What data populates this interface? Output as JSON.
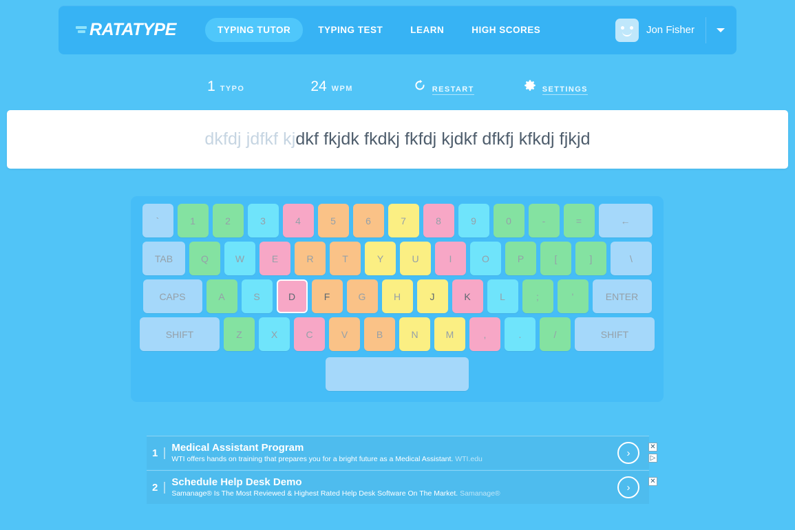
{
  "header": {
    "logo_text": "RATATYPE",
    "nav": [
      {
        "label": "TYPING TUTOR",
        "active": true
      },
      {
        "label": "TYPING TEST",
        "active": false
      },
      {
        "label": "LEARN",
        "active": false
      },
      {
        "label": "HIGH SCORES",
        "active": false
      }
    ],
    "username": "Jon Fisher"
  },
  "stats": {
    "typo_value": "1",
    "typo_label": "TYPO",
    "wpm_value": "24",
    "wpm_label": "WPM",
    "restart_label": "RESTART",
    "settings_label": "SETTINGS"
  },
  "typing": {
    "typed_text": "dkfdj jdfkf kj",
    "remaining_text": "dkf fkjdk fkdkj fkfdj kjdkf dfkfj kfkdj fjkjd"
  },
  "keyboard": {
    "active_key": "D",
    "rows": [
      [
        {
          "label": "`",
          "color": "blue",
          "width": "w-tick",
          "tone": "dim"
        },
        {
          "label": "1",
          "color": "green",
          "width": "",
          "tone": "dim"
        },
        {
          "label": "2",
          "color": "green",
          "width": "",
          "tone": "dim"
        },
        {
          "label": "3",
          "color": "cyan",
          "width": "",
          "tone": "dim"
        },
        {
          "label": "4",
          "color": "pink",
          "width": "",
          "tone": "dim"
        },
        {
          "label": "5",
          "color": "orange",
          "width": "",
          "tone": "dim"
        },
        {
          "label": "6",
          "color": "orange",
          "width": "",
          "tone": "dim"
        },
        {
          "label": "7",
          "color": "yellow",
          "width": "",
          "tone": "dim"
        },
        {
          "label": "8",
          "color": "pink",
          "width": "",
          "tone": "dim"
        },
        {
          "label": "9",
          "color": "cyan",
          "width": "",
          "tone": "dim"
        },
        {
          "label": "0",
          "color": "green",
          "width": "",
          "tone": "dim"
        },
        {
          "label": "-",
          "color": "green",
          "width": "",
          "tone": "dim"
        },
        {
          "label": "=",
          "color": "green",
          "width": "",
          "tone": "dim"
        },
        {
          "label": "←",
          "color": "blue",
          "width": "w-bksp",
          "tone": "dim"
        }
      ],
      [
        {
          "label": "TAB",
          "color": "blue",
          "width": "w-tab",
          "tone": "dim"
        },
        {
          "label": "Q",
          "color": "green",
          "width": "",
          "tone": "dim"
        },
        {
          "label": "W",
          "color": "cyan",
          "width": "",
          "tone": "dim"
        },
        {
          "label": "E",
          "color": "pink",
          "width": "",
          "tone": "dim"
        },
        {
          "label": "R",
          "color": "orange",
          "width": "",
          "tone": "dim"
        },
        {
          "label": "T",
          "color": "orange",
          "width": "",
          "tone": "dim"
        },
        {
          "label": "Y",
          "color": "yellow",
          "width": "",
          "tone": "dim"
        },
        {
          "label": "U",
          "color": "yellow",
          "width": "",
          "tone": "dim"
        },
        {
          "label": "I",
          "color": "pink",
          "width": "",
          "tone": "dim"
        },
        {
          "label": "O",
          "color": "cyan",
          "width": "",
          "tone": "dim"
        },
        {
          "label": "P",
          "color": "green",
          "width": "",
          "tone": "dim"
        },
        {
          "label": "[",
          "color": "green",
          "width": "",
          "tone": "dim"
        },
        {
          "label": "]",
          "color": "green",
          "width": "",
          "tone": "dim"
        },
        {
          "label": "\\",
          "color": "blue",
          "width": "w-bslash",
          "tone": "dim"
        }
      ],
      [
        {
          "label": "CAPS",
          "color": "blue",
          "width": "w-caps",
          "tone": "dim"
        },
        {
          "label": "A",
          "color": "green",
          "width": "",
          "tone": "dim"
        },
        {
          "label": "S",
          "color": "cyan",
          "width": "",
          "tone": "dim"
        },
        {
          "label": "D",
          "color": "pink",
          "width": "",
          "tone": "dark"
        },
        {
          "label": "F",
          "color": "orange",
          "width": "",
          "tone": "dark"
        },
        {
          "label": "G",
          "color": "orange",
          "width": "",
          "tone": "dim"
        },
        {
          "label": "H",
          "color": "yellow",
          "width": "",
          "tone": "dim"
        },
        {
          "label": "J",
          "color": "yellow",
          "width": "",
          "tone": "dark"
        },
        {
          "label": "K",
          "color": "pink",
          "width": "",
          "tone": "dark"
        },
        {
          "label": "L",
          "color": "cyan",
          "width": "",
          "tone": "dim"
        },
        {
          "label": ";",
          "color": "green",
          "width": "",
          "tone": "dim"
        },
        {
          "label": "'",
          "color": "green",
          "width": "",
          "tone": "dim"
        },
        {
          "label": "ENTER",
          "color": "blue",
          "width": "w-enter",
          "tone": "dim"
        }
      ],
      [
        {
          "label": "SHIFT",
          "color": "blue",
          "width": "w-lshift",
          "tone": "dim"
        },
        {
          "label": "Z",
          "color": "green",
          "width": "",
          "tone": "dim"
        },
        {
          "label": "X",
          "color": "cyan",
          "width": "",
          "tone": "dim"
        },
        {
          "label": "C",
          "color": "pink",
          "width": "",
          "tone": "dim"
        },
        {
          "label": "V",
          "color": "orange",
          "width": "",
          "tone": "dim"
        },
        {
          "label": "B",
          "color": "orange",
          "width": "",
          "tone": "dim"
        },
        {
          "label": "N",
          "color": "yellow",
          "width": "",
          "tone": "dim"
        },
        {
          "label": "M",
          "color": "yellow",
          "width": "",
          "tone": "dim"
        },
        {
          "label": ",",
          "color": "pink",
          "width": "",
          "tone": "dim"
        },
        {
          "label": ".",
          "color": "cyan",
          "width": "",
          "tone": "dim"
        },
        {
          "label": "/",
          "color": "green",
          "width": "",
          "tone": "dim"
        },
        {
          "label": "SHIFT",
          "color": "blue",
          "width": "w-rshift",
          "tone": "dim"
        }
      ],
      [
        {
          "label": "",
          "color": "blue",
          "width": "w-space",
          "tone": "dim"
        }
      ]
    ]
  },
  "ads": [
    {
      "rank": "1",
      "title": "Medical Assistant Program",
      "desc": "WTI offers hands on training that prepares you for a bright future as a Medical Assistant.",
      "source": "WTI.edu",
      "arrow": "›",
      "close": "✕",
      "info": "▷"
    },
    {
      "rank": "2",
      "title": "Schedule Help Desk Demo",
      "desc": "Samanage® Is The Most Reviewed & Highest Rated Help Desk Software On The Market.",
      "source": "Samanage®",
      "arrow": "›",
      "close": "✕",
      "info": ""
    }
  ],
  "colors": {
    "page_background": "#51c4f7",
    "header_background": "#37b3f4",
    "nav_active": "#4fc7fb",
    "keyboard_background": "#46bdf7",
    "key_green": "#84e2a1",
    "key_cyan": "#6fe4fb",
    "key_pink": "#f7a7c6",
    "key_orange": "#fac287",
    "key_yellow": "#fbef83",
    "key_blue": "#a5d8fa",
    "ad_background": "#4ebcee"
  }
}
